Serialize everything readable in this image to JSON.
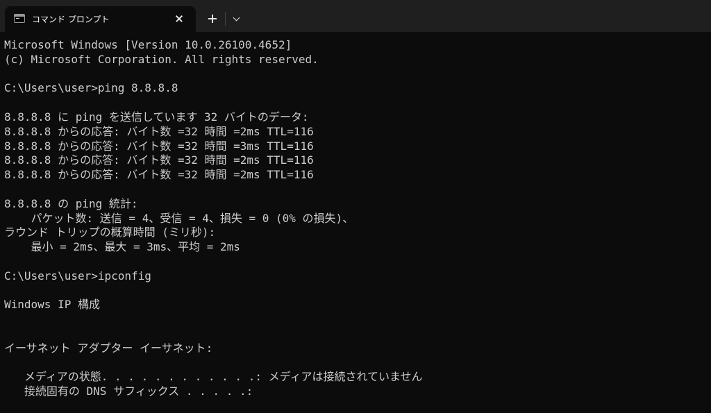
{
  "window": {
    "tab_title": "コマンド プロンプト"
  },
  "icons": {
    "tab": "cmd-prompt-icon",
    "close": "close-icon",
    "new_tab": "plus-icon",
    "dropdown": "chevron-down-icon"
  },
  "colors": {
    "background": "#0c0c0c",
    "titlebar": "#1f1f1f",
    "text": "#cccccc"
  },
  "terminal": {
    "lines": [
      "Microsoft Windows [Version 10.0.26100.4652]",
      "(c) Microsoft Corporation. All rights reserved.",
      "",
      "C:\\Users\\user>ping 8.8.8.8",
      "",
      "8.8.8.8 に ping を送信しています 32 バイトのデータ:",
      "8.8.8.8 からの応答: バイト数 =32 時間 =2ms TTL=116",
      "8.8.8.8 からの応答: バイト数 =32 時間 =3ms TTL=116",
      "8.8.8.8 からの応答: バイト数 =32 時間 =2ms TTL=116",
      "8.8.8.8 からの応答: バイト数 =32 時間 =2ms TTL=116",
      "",
      "8.8.8.8 の ping 統計:",
      "    パケット数: 送信 = 4、受信 = 4、損失 = 0 (0% の損失)、",
      "ラウンド トリップの概算時間 (ミリ秒):",
      "    最小 = 2ms、最大 = 3ms、平均 = 2ms",
      "",
      "C:\\Users\\user>ipconfig",
      "",
      "Windows IP 構成",
      "",
      "",
      "イーサネット アダプター イーサネット:",
      "",
      "   メディアの状態. . . . . . . . . . . .: メディアは接続されていません",
      "   接続固有の DNS サフィックス . . . . .:"
    ]
  }
}
